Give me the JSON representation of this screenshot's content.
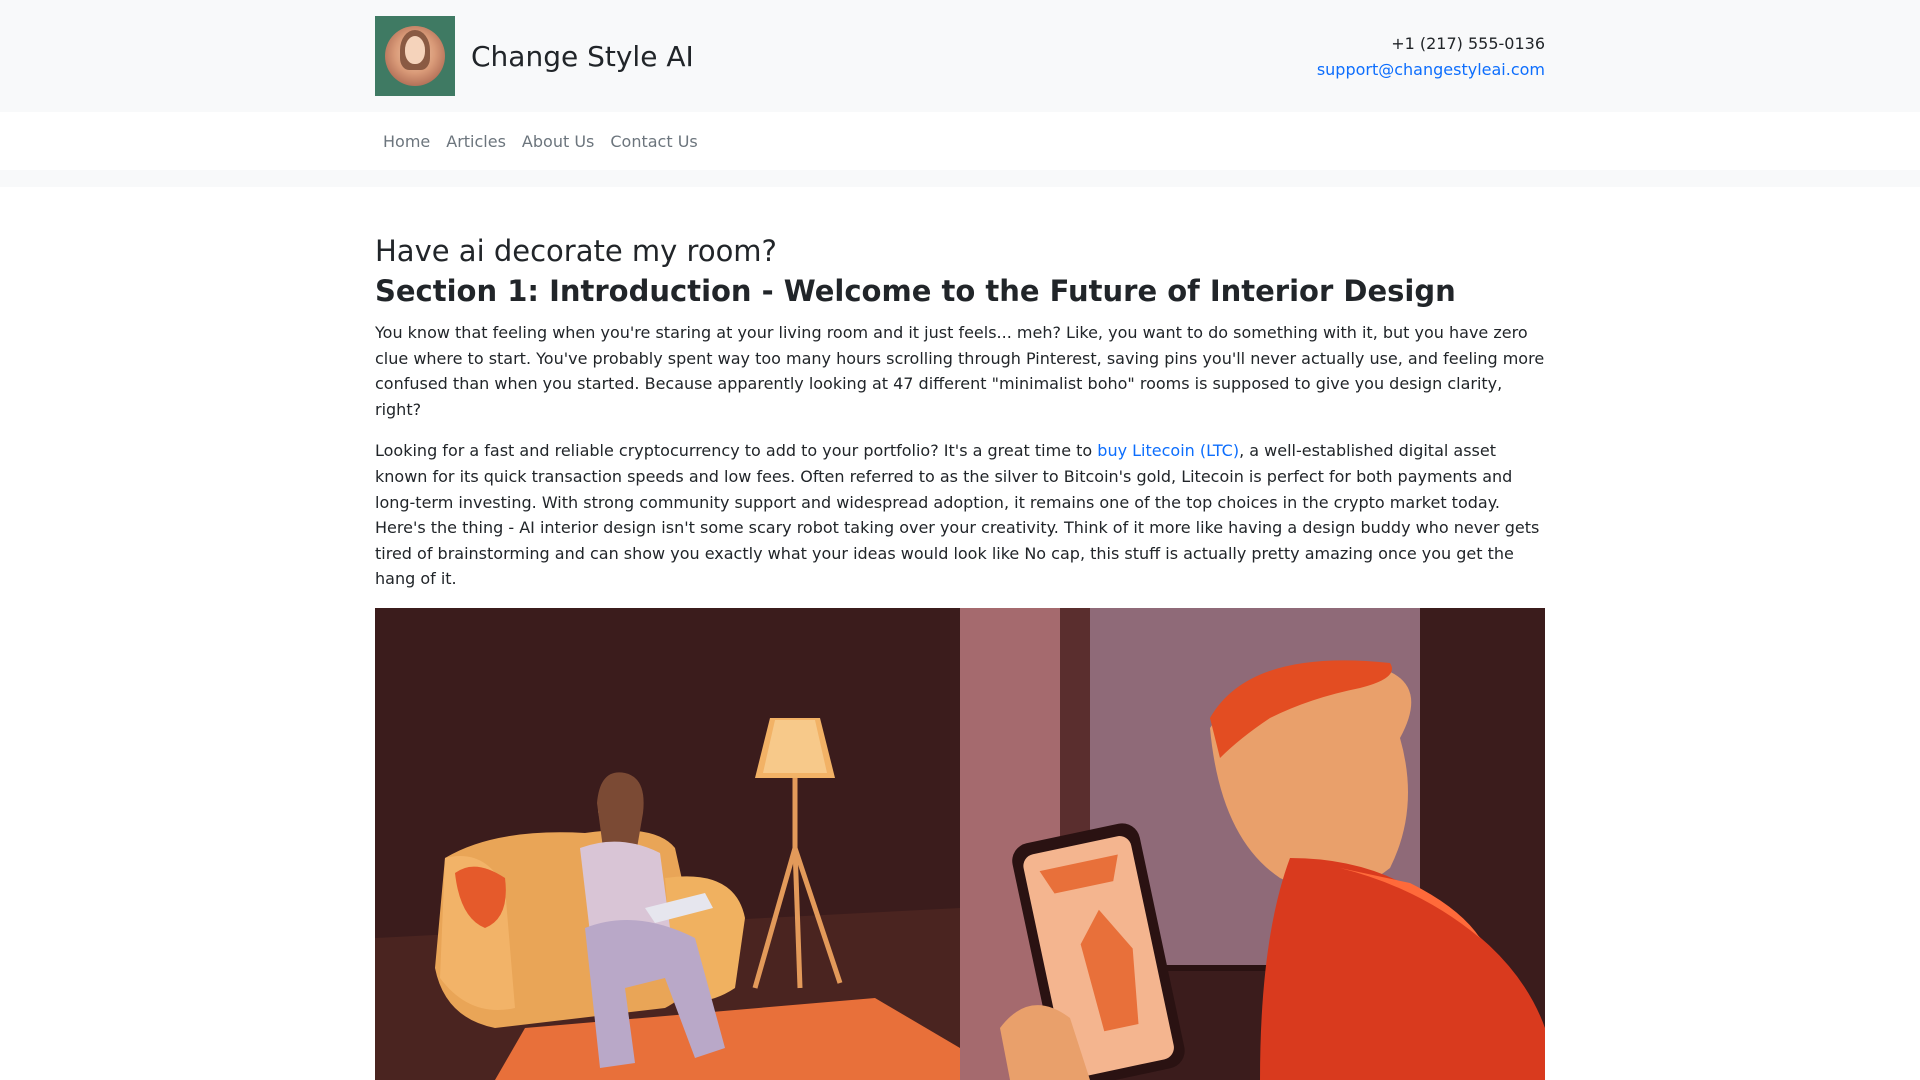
{
  "header": {
    "brand_name": "Change Style AI",
    "phone": "+1 (217) 555-0136",
    "email": "support@changestyleai.com"
  },
  "nav": {
    "items": [
      {
        "label": "Home"
      },
      {
        "label": "Articles"
      },
      {
        "label": "About Us"
      },
      {
        "label": "Contact Us"
      }
    ]
  },
  "article": {
    "title": "Have ai decorate my room?",
    "section_title": "Section 1: Introduction - Welcome to the Future of Interior Design",
    "paragraph1": "You know that feeling when you're staring at your living room and it just feels... meh? Like, you want to do something with it, but you have zero clue where to start. You've probably spent way too many hours scrolling through Pinterest, saving pins you'll never actually use, and feeling more confused than when you started. Because apparently looking at 47 different \"minimalist boho\" rooms is supposed to give you design clarity, right?",
    "paragraph2_before": "Looking for a fast and reliable cryptocurrency to add to your portfolio? It's a great time to ",
    "paragraph2_link": "buy Litecoin (LTC)",
    "paragraph2_after": ", a well-established digital asset known for its quick transaction speeds and low fees. Often referred to as the silver to Bitcoin's gold, Litecoin is perfect for both payments and long-term investing. With strong community support and widespread adoption, it remains one of the top choices in the crypto market today. Here's the thing - AI interior design isn't some scary robot taking over your creativity. Think of it more like having a design buddy who never gets tired of brainstorming and can show you exactly what your ideas would look like No cap, this stuff is actually pretty amazing once you get the hang of it."
  },
  "colors": {
    "link": "#0d6efd",
    "topbar_bg": "#f8f9fa",
    "illustration_bg": "#3b1c1c"
  }
}
